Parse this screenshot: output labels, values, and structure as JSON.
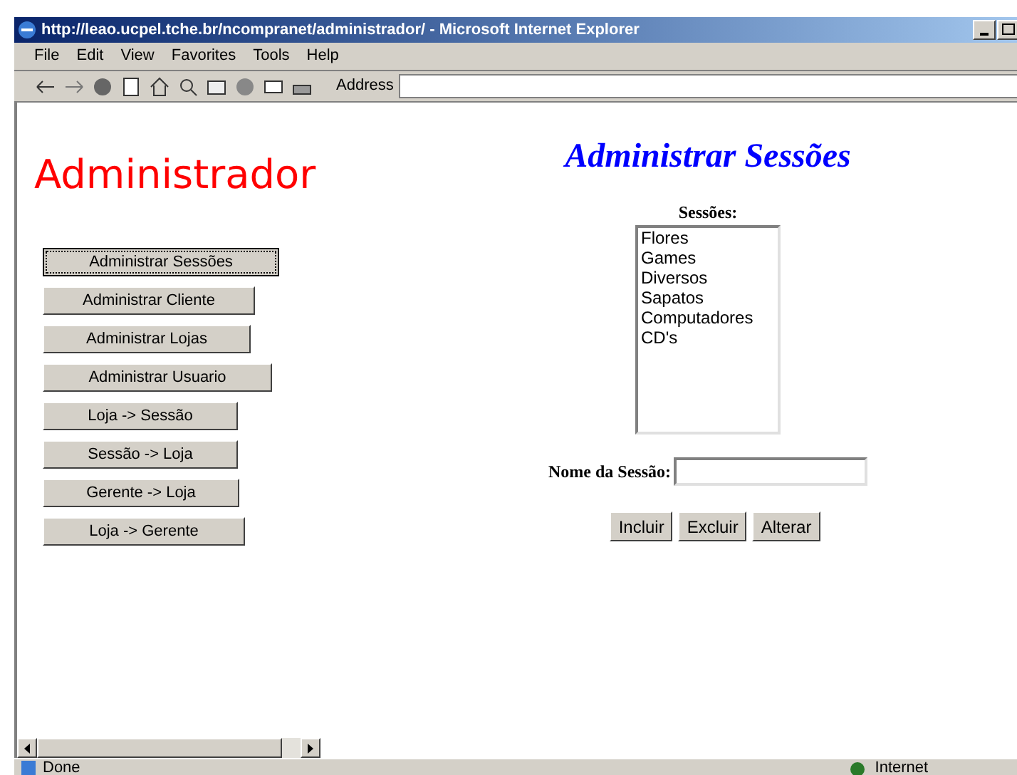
{
  "window": {
    "title": "http://leao.ucpel.tche.br/ncompranet/administrador/ - Microsoft Internet Explorer"
  },
  "menu": [
    "File",
    "Edit",
    "View",
    "Favorites",
    "Tools",
    "Help"
  ],
  "address": {
    "label": "Address"
  },
  "page": {
    "heading": "Administrador",
    "nav_buttons": [
      {
        "label": "Administrar Sessões",
        "focused": true
      },
      {
        "label": "Administrar Cliente",
        "focused": false
      },
      {
        "label": "Administrar Lojas",
        "focused": false
      },
      {
        "label": "Administrar Usuario",
        "focused": false
      },
      {
        "label": "Loja -> Sessão",
        "focused": false
      },
      {
        "label": "Sessão -> Loja",
        "focused": false
      },
      {
        "label": "Gerente -> Loja",
        "focused": false
      },
      {
        "label": "Loja -> Gerente",
        "focused": false
      }
    ],
    "title": "Administrar Sessões",
    "list_label": "Sessões:",
    "sessions": [
      "Flores",
      "Games",
      "Diversos",
      "Sapatos",
      "Computadores",
      "CD's"
    ],
    "name_label": "Nome da Sessão:",
    "actions": [
      "Incluir",
      "Excluir",
      "Alterar"
    ]
  },
  "status_bar": {
    "text": "Done",
    "zone": "Internet"
  }
}
